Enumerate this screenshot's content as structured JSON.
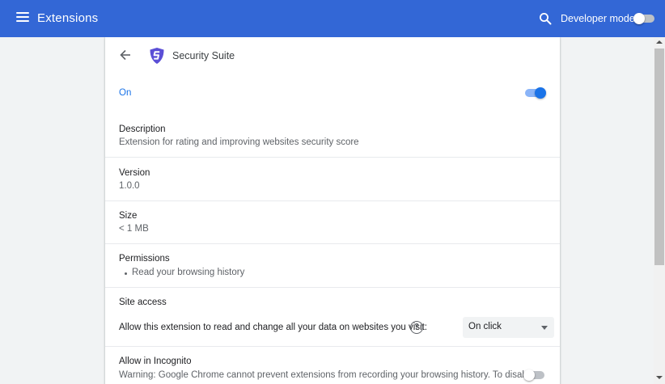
{
  "topbar": {
    "title": "Extensions",
    "developer_mode_label": "Developer mode",
    "developer_mode_on": false,
    "color": "#3367d6"
  },
  "extension": {
    "name": "Security Suite",
    "logo_icon": "shield-s-logo",
    "status_label": "On",
    "enabled": true
  },
  "details": {
    "description_label": "Description",
    "description_value": "Extension for rating and improving websites security score",
    "version_label": "Version",
    "version_value": "1.0.0",
    "size_label": "Size",
    "size_value": "< 1 MB",
    "permissions_label": "Permissions",
    "permissions": [
      "Read your browsing history"
    ]
  },
  "site_access": {
    "label": "Site access",
    "text": "Allow this extension to read and change all your data on websites you visit:",
    "help_glyph": "?",
    "selected": "On click"
  },
  "incognito": {
    "label": "Allow in Incognito",
    "warning": "Warning: Google Chrome cannot prevent extensions from recording your browsing history. To disable",
    "enabled": false
  },
  "colors": {
    "accent": "#1a73e8",
    "toggle_track_on": "#8ab4f8",
    "toggle_off": "#bdc1c6"
  }
}
